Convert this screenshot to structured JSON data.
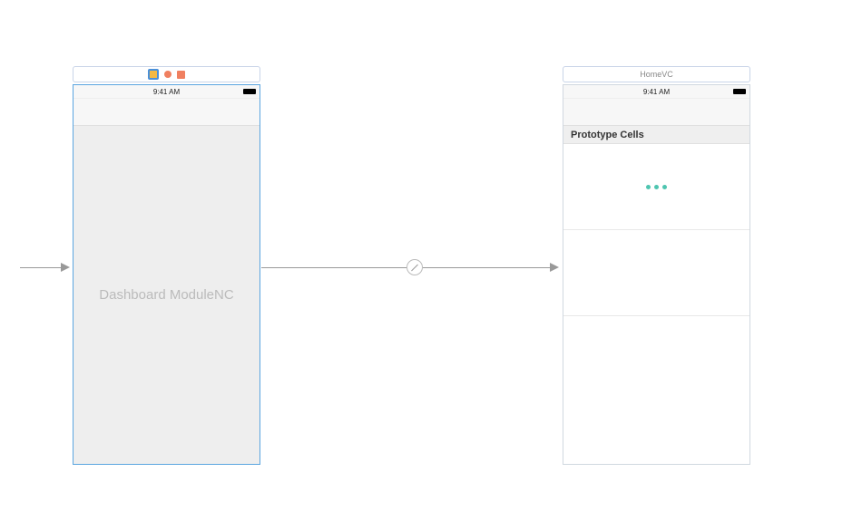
{
  "scene1": {
    "status_time": "9:41 AM",
    "placeholder": "Dashboard ModuleNC"
  },
  "scene2": {
    "header_title": "HomeVC",
    "status_time": "9:41 AM",
    "section_header": "Prototype Cells"
  }
}
